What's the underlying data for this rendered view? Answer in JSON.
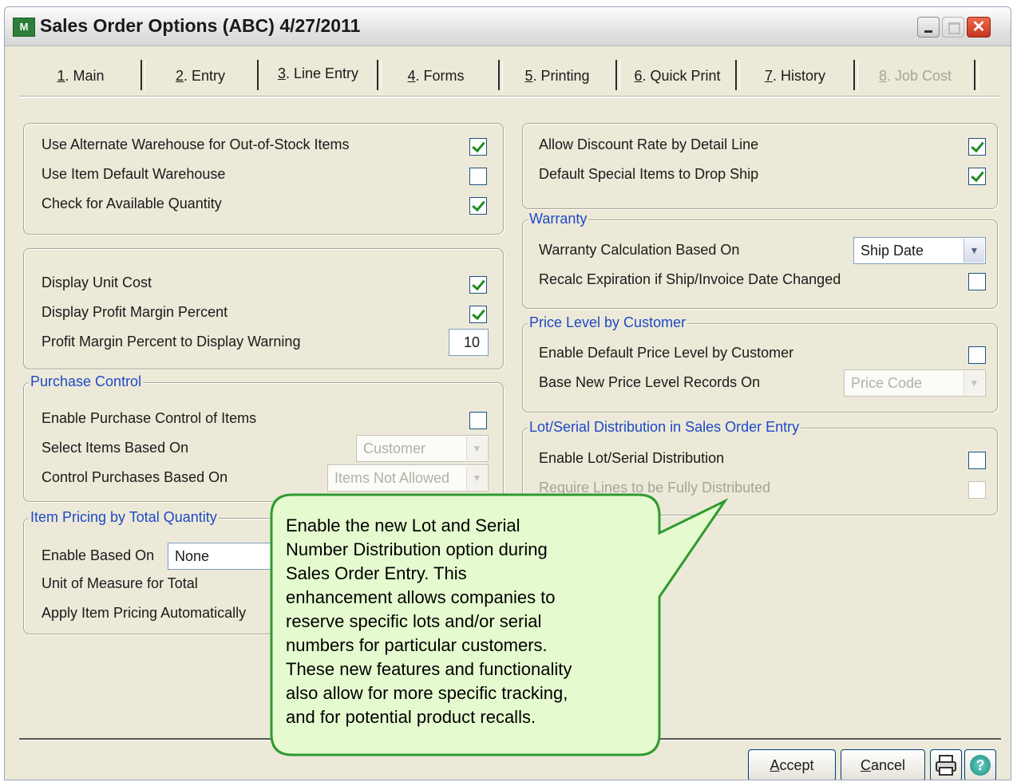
{
  "window": {
    "title": "Sales Order Options (ABC) 4/27/2011",
    "app_icon_glyph": "M",
    "buttons": {
      "minimize": "minimize",
      "maximize": "maximize",
      "close": "✕"
    }
  },
  "tabs": [
    {
      "key": "1",
      "rest": ". Main"
    },
    {
      "key": "2",
      "rest": ". Entry"
    },
    {
      "key": "3",
      "rest": ". Line Entry"
    },
    {
      "key": "4",
      "rest": ". Forms"
    },
    {
      "key": "5",
      "rest": ". Printing"
    },
    {
      "key": "6",
      "rest": ". Quick Print"
    },
    {
      "key": "7",
      "rest": ". History"
    },
    {
      "key": "8",
      "rest": ". Job Cost"
    }
  ],
  "active_tab_index": 2,
  "left": {
    "warehouse": {
      "use_alternate_warehouse": {
        "label": "Use Alternate Warehouse for Out-of-Stock Items",
        "checked": true
      },
      "use_item_default_warehouse": {
        "label": "Use Item Default Warehouse",
        "checked": false
      },
      "check_available_quantity": {
        "label": "Check for Available Quantity",
        "checked": true
      }
    },
    "cost": {
      "display_unit_cost": {
        "label": "Display Unit Cost",
        "checked": true
      },
      "display_profit_margin": {
        "label": "Display Profit Margin Percent",
        "checked": true
      },
      "profit_margin_warning": {
        "label": "Profit Margin Percent to Display Warning",
        "value": "10"
      }
    },
    "purchase_control": {
      "legend": "Purchase Control",
      "enable": {
        "label": "Enable Purchase Control of Items",
        "checked": false
      },
      "select_items": {
        "label": "Select Items Based On",
        "value": "Customer"
      },
      "control_purchases": {
        "label": "Control Purchases Based On",
        "value": "Items Not Allowed"
      }
    },
    "item_pricing": {
      "legend": "Item Pricing by Total Quantity",
      "enable_based_on": {
        "label": "Enable Based On",
        "value": "None"
      },
      "unit_of_measure": {
        "label": "Unit of Measure for Total"
      },
      "apply_automatically": {
        "label": "Apply Item Pricing Automatically"
      }
    }
  },
  "right": {
    "discount": {
      "allow_discount_rate": {
        "label": "Allow Discount Rate by Detail Line",
        "checked": true
      },
      "default_special_drop_ship": {
        "label": "Default Special Items to Drop Ship",
        "checked": true
      }
    },
    "warranty": {
      "legend": "Warranty",
      "calc_based_on": {
        "label": "Warranty Calculation Based On",
        "value": "Ship Date"
      },
      "recalc_expiration": {
        "label": "Recalc Expiration if Ship/Invoice Date Changed",
        "checked": false
      }
    },
    "price_level": {
      "legend": "Price Level by Customer",
      "enable_default": {
        "label": "Enable Default Price Level by Customer",
        "checked": false
      },
      "base_new_records": {
        "label": "Base New Price Level Records On",
        "value": "Price Code"
      }
    },
    "lot_serial": {
      "legend": "Lot/Serial Distribution in Sales Order Entry",
      "enable": {
        "label": "Enable Lot/Serial Distribution",
        "checked": false
      },
      "require_fully_distributed": {
        "label": "Require Lines to be Fully Distributed",
        "checked": false
      }
    }
  },
  "callout": {
    "text": "Enable the new Lot and Serial\nNumber Distribution option during\nSales Order Entry. This\nenhancement allows companies to\nreserve specific lots and/or serial\nnumbers for particular customers.\nThese new features and functionality\nalso allow for more specific tracking,\nand for potential product recalls.",
    "fill": "#e5fbcf",
    "border": "#2f9a2f"
  },
  "footer": {
    "accept": {
      "key": "A",
      "rest": "ccept"
    },
    "cancel": {
      "key": "C",
      "rest": "ancel"
    },
    "print_icon": "printer-icon",
    "help_icon": "help-icon",
    "help_glyph": "?"
  },
  "colors": {
    "legend": "#1f49c7",
    "window_bg": "#ece9d8",
    "checkmark": "#218b21"
  }
}
